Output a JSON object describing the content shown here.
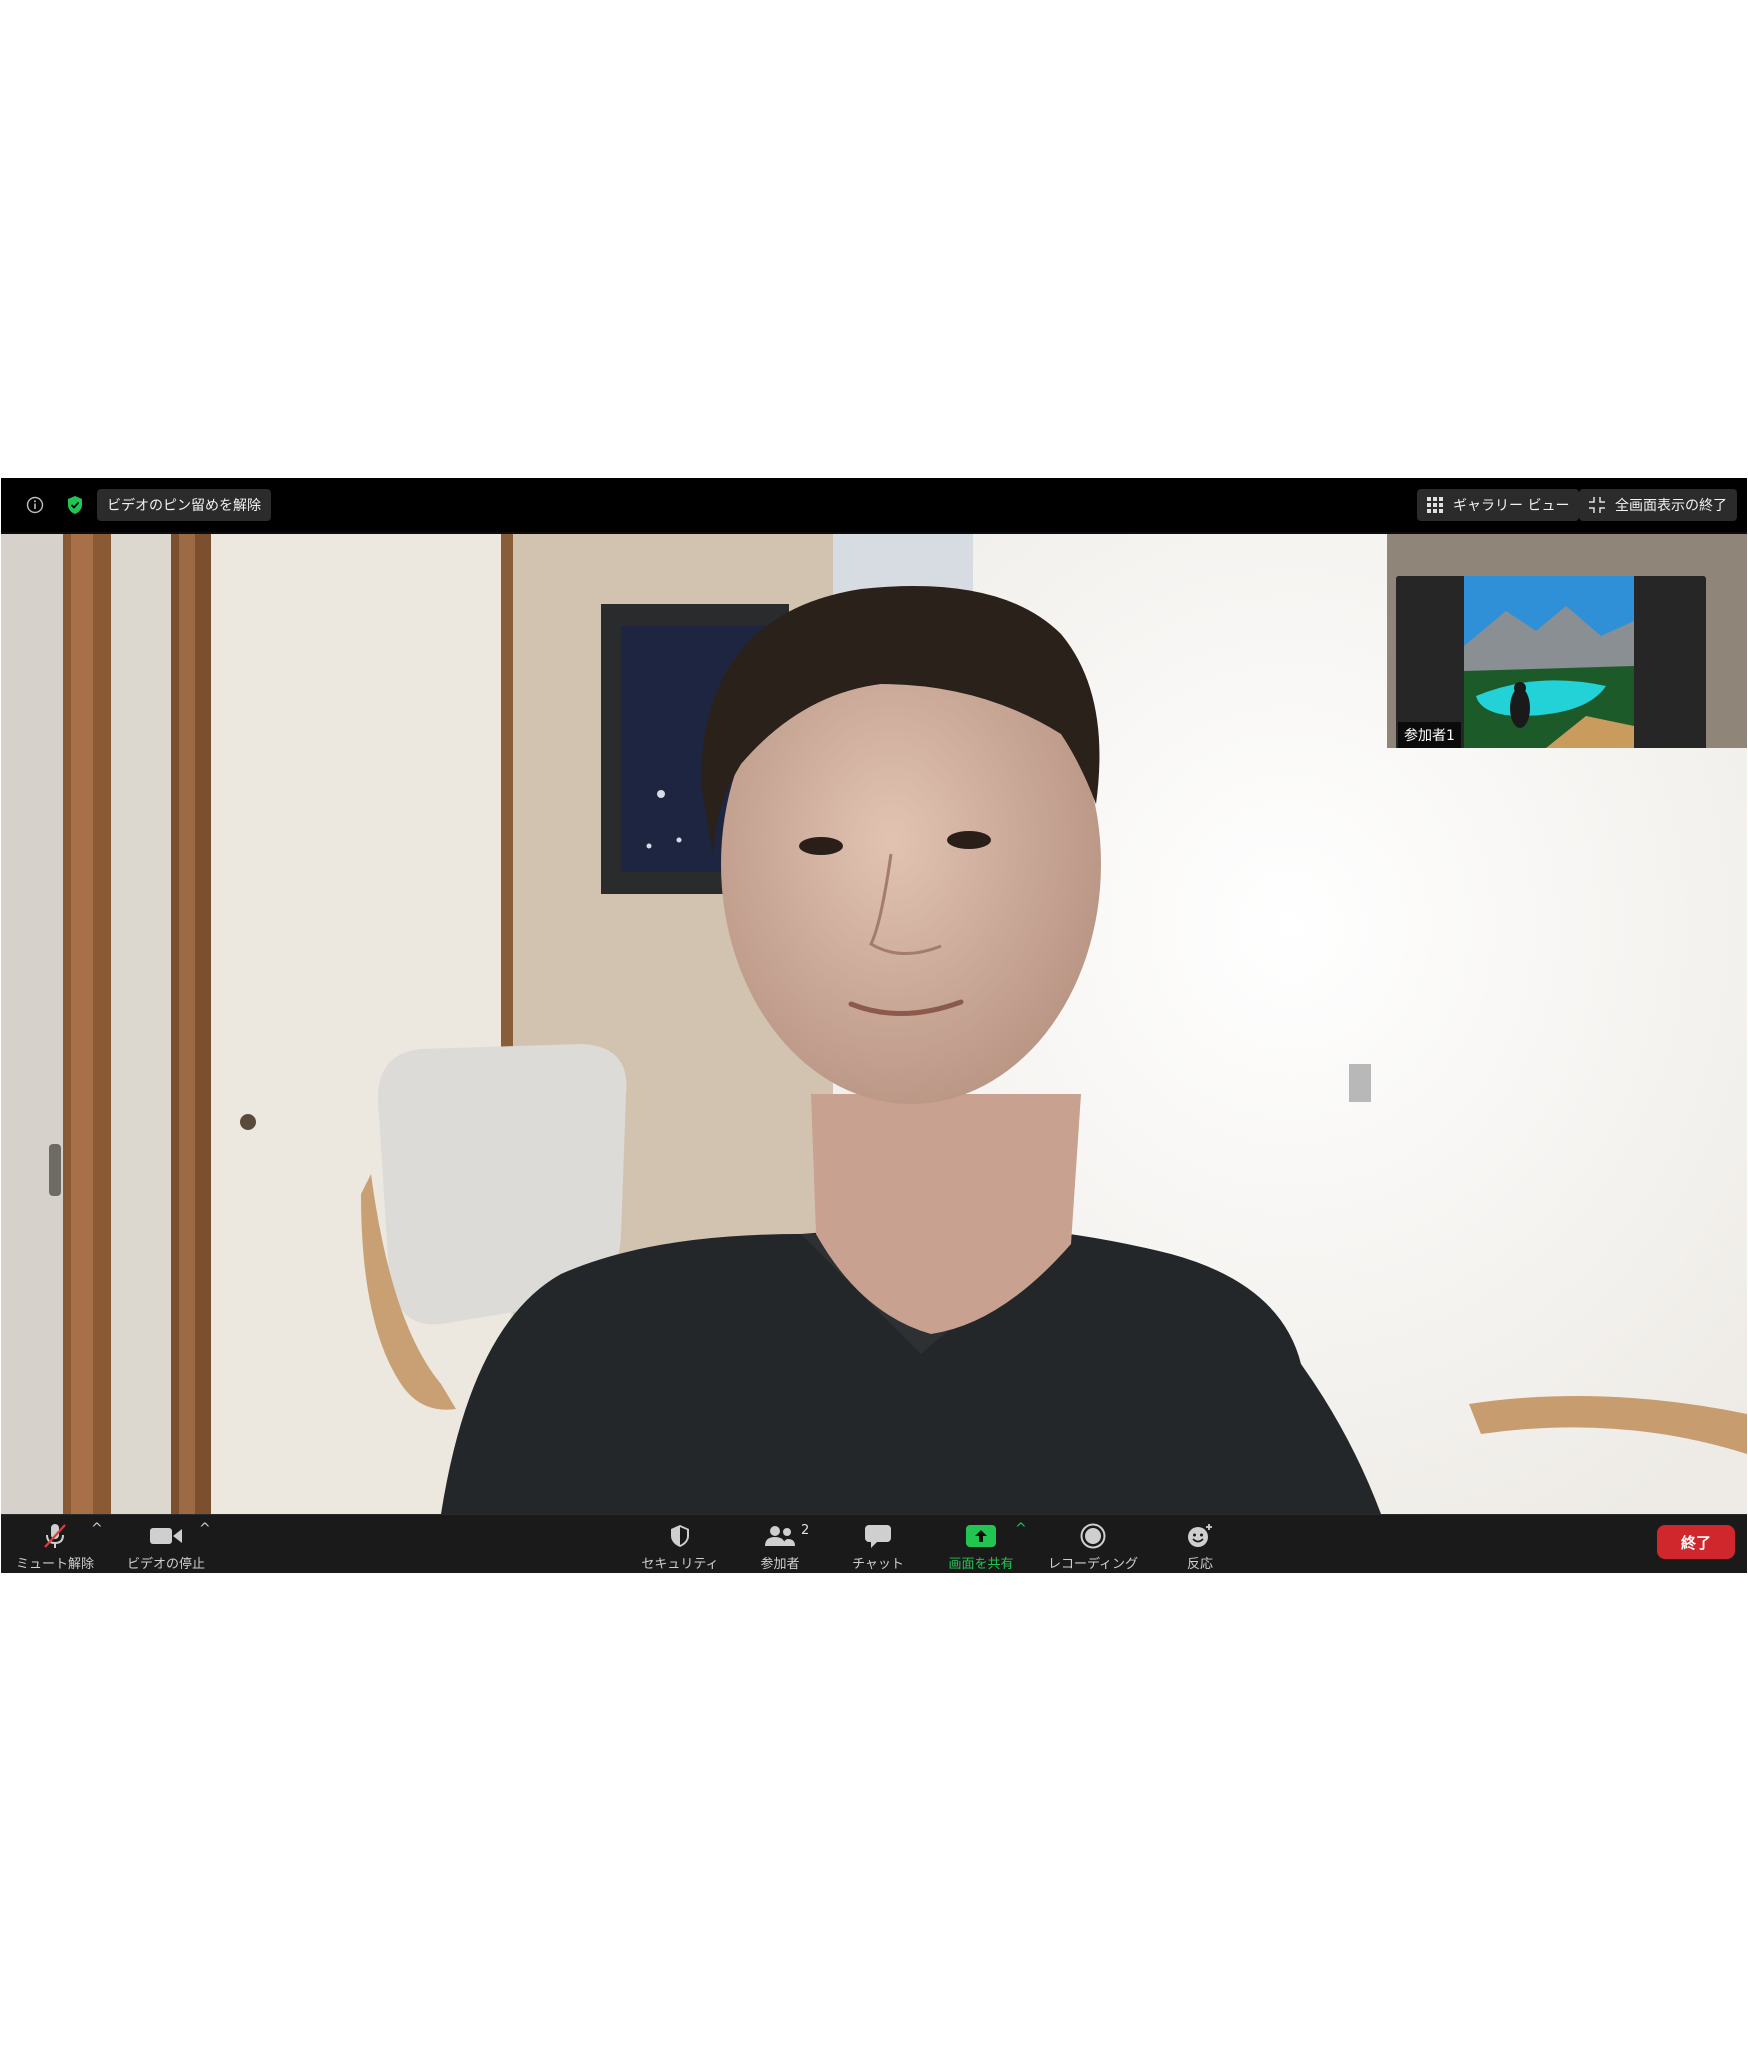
{
  "topbar": {
    "unpin_label": "ビデオのピン留めを解除",
    "gallery_label": "ギャラリー ビュー",
    "exit_fullscreen_label": "全画面表示の終了"
  },
  "thumbnail": {
    "participant_name": "参加者1"
  },
  "toolbar": {
    "mute_label": "ミュート解除",
    "video_label": "ビデオの停止",
    "security_label": "セキュリティ",
    "participants_label": "参加者",
    "participants_count": "2",
    "chat_label": "チャット",
    "share_label": "画面を共有",
    "record_label": "レコーディング",
    "reactions_label": "反応",
    "end_label": "終了"
  },
  "colors": {
    "share_green": "#23c552",
    "end_red": "#d0272c",
    "security_green": "#23c552"
  },
  "icons": [
    "info-icon",
    "shield-check-icon",
    "gallery-grid-icon",
    "exit-fullscreen-icon",
    "mic-muted-icon",
    "video-camera-icon",
    "security-shield-icon",
    "participants-icon",
    "chat-icon",
    "share-screen-icon",
    "record-icon",
    "reaction-icon"
  ]
}
